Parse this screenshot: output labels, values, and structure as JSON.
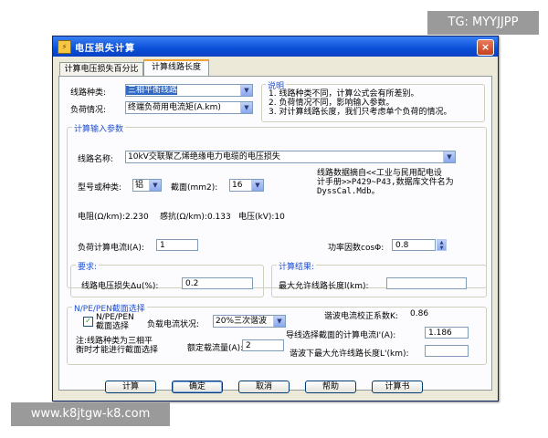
{
  "watermark_top": "TG: MYYJJPP",
  "watermark_bottom": "www.k8jtgw-k8.com",
  "window": {
    "title": "电压损失计算",
    "close_label": "×"
  },
  "tabs": [
    {
      "label": "计算电压损失百分比",
      "active": false
    },
    {
      "label": "计算线路长度",
      "active": true
    }
  ],
  "line_type": {
    "label": "线路种类:",
    "value": "三相平衡线路"
  },
  "load_type": {
    "label": "负荷情况:",
    "value": "终端负荷用电流矩(A.km)"
  },
  "notes": {
    "title": "说明",
    "lines": [
      "1. 线路种类不同，计算公式会有所差别。",
      "2. 负荷情况不同，影响输入参数。",
      "3. 对计算线路长度，我们只考虑单个负荷的情况。"
    ]
  },
  "input_group": {
    "title": "计算输入参数",
    "line_name_label": "线路名称:",
    "line_name_value": "10kV交联聚乙烯绝缘电力电缆的电压损失",
    "model_label": "型号或种类:",
    "model_value": "铝",
    "section_label": "截面(mm2):",
    "section_value": "16",
    "data_source": [
      "线路数据摘自<<工业与民用配电设",
      "计手册>>P429~P43,数据库文件名为",
      "DyssCal.Mdb。"
    ],
    "resistance": "电阻(Ω/km):2.230",
    "reactance": "感抗(Ω/km):0.133",
    "voltage": "电压(kV):10",
    "load_current_label": "负荷计算电流I(A):",
    "load_current_value": "1",
    "power_factor_label": "功率因数cosΦ:",
    "power_factor_value": "0.8"
  },
  "requirement_group": {
    "title": "要求:",
    "vloss_label": "线路电压损失Δu(%):",
    "vloss_value": "0.2"
  },
  "result_group": {
    "title": "计算结果:",
    "max_len_label": "最大允许线路长度l(km):",
    "max_len_value": ""
  },
  "section_group": {
    "title": "N/PE/PEN截面选择",
    "checkbox_checked": true,
    "checkbox_label_1": "N/PE/PEN",
    "checkbox_label_2": "截面选择",
    "load_current_status_label": "负载电流状况:",
    "load_current_status_value": "20%三次谐波",
    "harmonic_factor_label": "谐波电流校正系数K:",
    "harmonic_factor_value": "0.86",
    "note_lines": [
      "注:线路种类为三相平",
      "衡时才能进行截面选择"
    ],
    "rated_current_label": "额定载流量(A):",
    "rated_current_value": "2",
    "design_current_label": "导线选择截面的计算电流I'(A):",
    "design_current_value": "1.186",
    "harmonic_max_len_label": "谐波下最大允许线路长度L'(km):",
    "harmonic_max_len_value": ""
  },
  "buttons": {
    "calc": "计算",
    "ok": "确定",
    "cancel": "取消",
    "help": "帮助",
    "report": "计算书"
  }
}
